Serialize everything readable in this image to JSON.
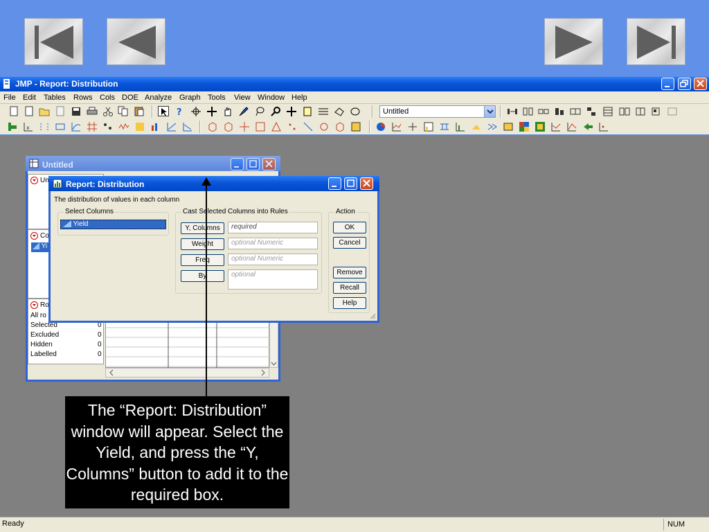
{
  "nav": {
    "first": "first-slide",
    "prev": "previous-slide",
    "next": "next-slide",
    "last": "last-slide"
  },
  "app": {
    "title": "JMP - Report: Distribution"
  },
  "menu": [
    "File",
    "Edit",
    "Tables",
    "Rows",
    "Cols",
    "DOE",
    "Analyze",
    "Graph",
    "Tools",
    "View",
    "Window",
    "Help"
  ],
  "toolbar": {
    "table_select": "Untitled"
  },
  "untitled_window": {
    "title": "Untitled",
    "panel1_label": "Unt",
    "panel2_label": "Co",
    "panel2_item": "Yi",
    "panel3_label": "Ro",
    "rows": [
      {
        "label": "All ro",
        "value": ""
      },
      {
        "label": "Selected",
        "value": "0"
      },
      {
        "label": "Excluded",
        "value": "0"
      },
      {
        "label": "Hidden",
        "value": "0"
      },
      {
        "label": "Labelled",
        "value": "0"
      }
    ]
  },
  "dialog": {
    "title": "Report: Distribution",
    "description": "The distribution of values in each column",
    "select_columns_label": "Select Columns",
    "columns": [
      "Yield"
    ],
    "cast_label": "Cast Selected Columns into Rules",
    "roles": [
      {
        "button": "Y, Columns",
        "placeholder": "required"
      },
      {
        "button": "Weight",
        "placeholder": "optional Numeric"
      },
      {
        "button": "Freq",
        "placeholder": "optional Numeric"
      },
      {
        "button": "By",
        "placeholder": "optional"
      }
    ],
    "action_label": "Action",
    "actions": [
      "OK",
      "Cancel",
      "Remove",
      "Recall",
      "Help"
    ]
  },
  "callout": "The “Report: Distribution” window will appear. Select the Yield, and press the “Y, Columns” button to add it to the required box.",
  "status": {
    "left": "Ready",
    "right": "NUM"
  },
  "colors": {
    "accent": "#0a55d8",
    "slide_bg": "#6090e8",
    "workspace": "#808080"
  }
}
